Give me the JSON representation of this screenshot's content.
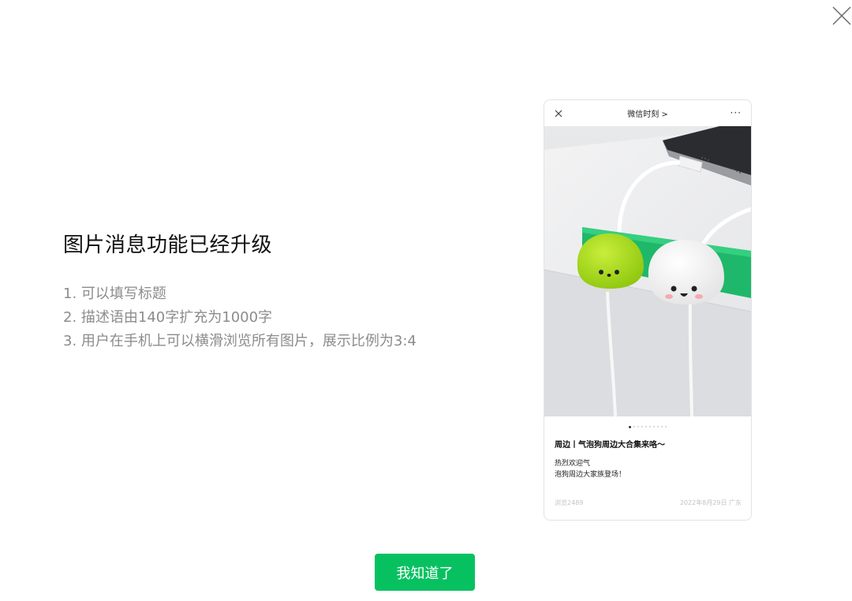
{
  "dialog": {
    "title": "图片消息功能已经升级",
    "features": [
      "1. 可以填写标题",
      "2. 描述语由140字扩充为1000字",
      "3. 用户在手机上可以横滑浏览所有图片，展示比例为3:4"
    ],
    "confirm_label": "我知道了"
  },
  "preview": {
    "header_title": "微信时刻 >",
    "more_label": "···",
    "article_title": "周边丨气泡狗周边大合集来咯～",
    "description_lines": [
      "热烈欢迎气",
      "泡狗周边大家族登场！"
    ],
    "views": "浏览2489",
    "date_location": "2022年8月29日 广东",
    "pager_dots": 10,
    "active_dot": 0
  },
  "colors": {
    "accent": "#07c160",
    "title_text": "#111111",
    "list_text": "#8c8c8c"
  },
  "icons": [
    "close-icon",
    "more-icon"
  ]
}
